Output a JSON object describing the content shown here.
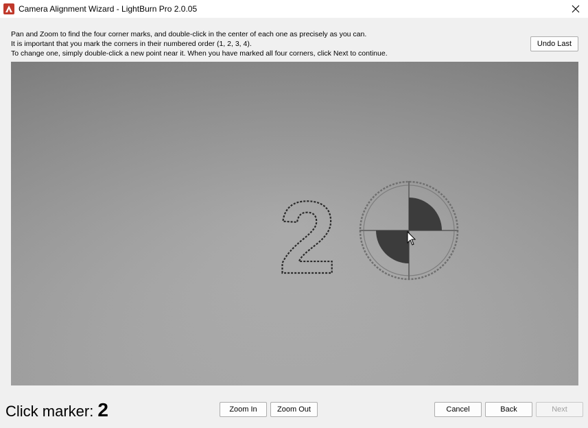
{
  "window": {
    "title": "Camera Alignment Wizard - LightBurn Pro 2.0.05"
  },
  "instructions": {
    "line1": "Pan and Zoom to find the four corner marks, and double-click in the center of each one as precisely as you can.",
    "line2": "It is important that you mark the corners in their numbered order (1, 2, 3, 4).",
    "line3": "To change one, simply double-click a new point near it.  When you have marked all four corners, click Next to continue."
  },
  "toolbar": {
    "undo_label": "Undo Last"
  },
  "camera": {
    "target_number": "2"
  },
  "status": {
    "label": "Click marker:",
    "marker": "2"
  },
  "footer": {
    "zoom_in_label": "Zoom In",
    "zoom_out_label": "Zoom Out",
    "cancel_label": "Cancel",
    "back_label": "Back",
    "next_label": "Next"
  },
  "icons": {
    "app": "lightburn-logo-icon",
    "close": "close-icon",
    "cursor": "mouse-pointer-icon"
  },
  "colors": {
    "accent": "#0078d7",
    "app_icon": "#c0392b"
  }
}
